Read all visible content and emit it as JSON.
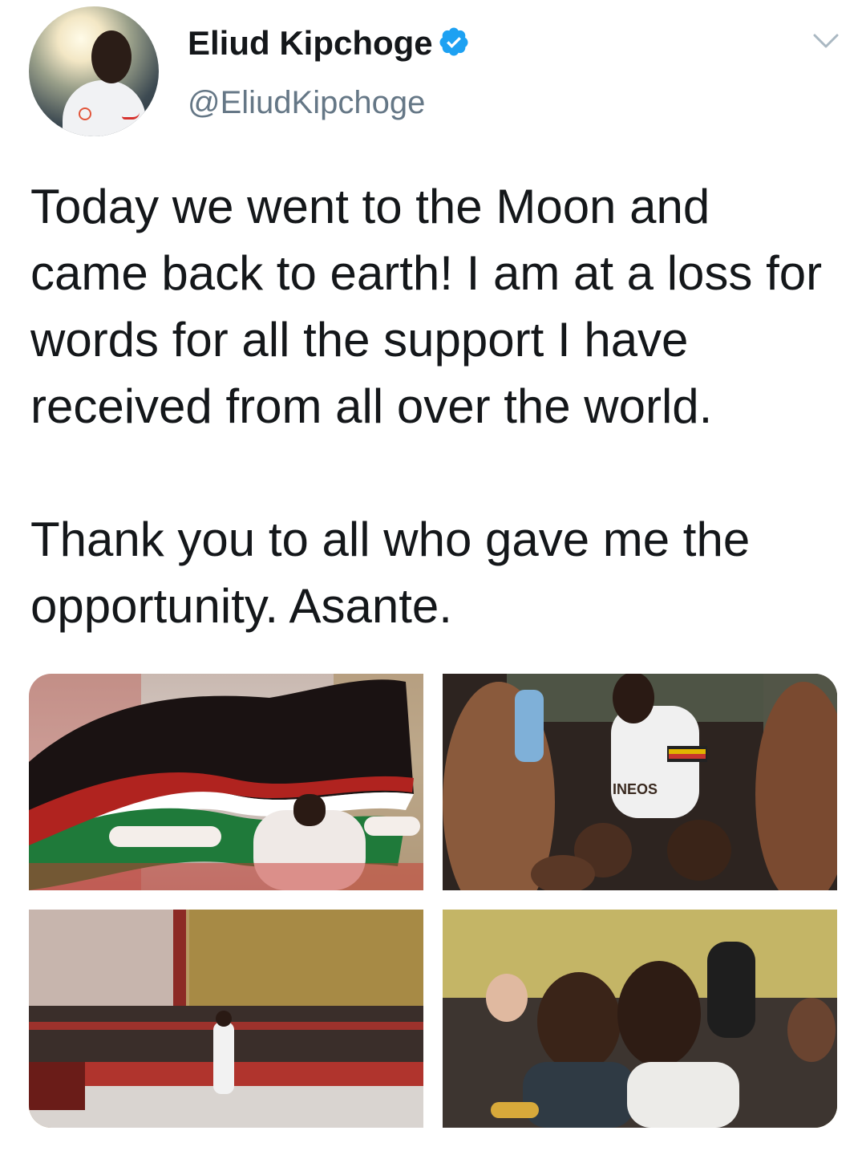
{
  "author": {
    "name": "Eliud Kipchoge",
    "handle": "@EliudKipchoge",
    "verified": true,
    "verified_color": "#1da1f2"
  },
  "tweet": {
    "paragraphs": [
      "Today we went to the Moon and came back to earth! I am at a loss for words for all the support I have received from all over the world.",
      "Thank you to all who gave me the opportunity. Asante."
    ]
  },
  "media": {
    "photo_1_text": "",
    "photo_2_text": "INEOS",
    "photo_4_text": ""
  },
  "icons": {
    "menu": "chevron-down-icon",
    "verified": "verified-badge-icon"
  }
}
